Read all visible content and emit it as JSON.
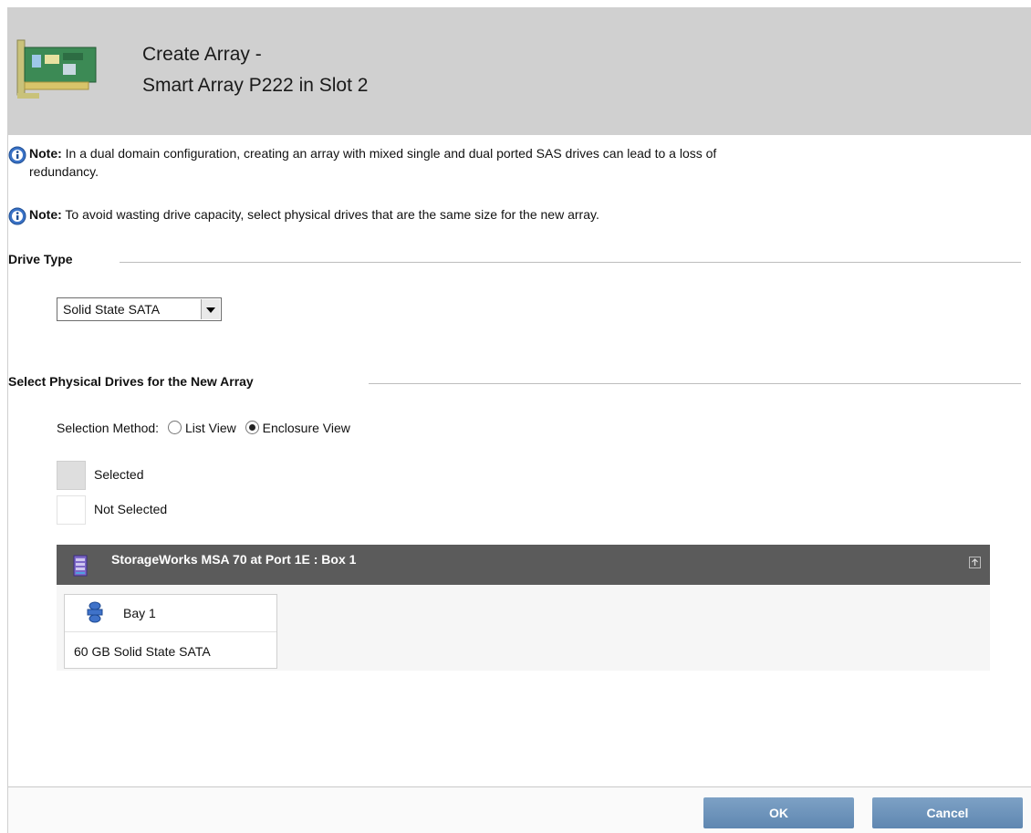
{
  "header": {
    "title_line1": "Create Array -",
    "title_line2": "Smart Array P222 in Slot 2",
    "icon": "controller-card-icon"
  },
  "notes": [
    {
      "label": "Note:",
      "text_line1": "In a dual domain configuration, creating an array with mixed single and dual ported SAS drives can lead to a loss of",
      "text_line2": "redundancy."
    },
    {
      "label": "Note:",
      "text": "To avoid wasting drive capacity, select physical drives that are the same size for the new array."
    }
  ],
  "drive_type": {
    "section_title": "Drive Type",
    "selected": "Solid State SATA"
  },
  "physical_drives": {
    "section_title": "Select Physical Drives for the New Array",
    "selection_method_label": "Selection Method:",
    "options": [
      "List View",
      "Enclosure View"
    ],
    "selected_option": "Enclosure View",
    "legend": {
      "selected": "Selected",
      "not_selected": "Not Selected"
    },
    "enclosure": {
      "title": "StorageWorks MSA 70 at Port 1E : Box 1",
      "bays": [
        {
          "label": "Bay 1",
          "capacity": "60 GB Solid State SATA"
        }
      ]
    }
  },
  "footer": {
    "ok_label": "OK",
    "cancel_label": "Cancel"
  },
  "colors": {
    "header_bg": "#d0d0d0",
    "enclosure_header_bg": "#5b5b5b",
    "button_blue": "#6f94bb"
  }
}
